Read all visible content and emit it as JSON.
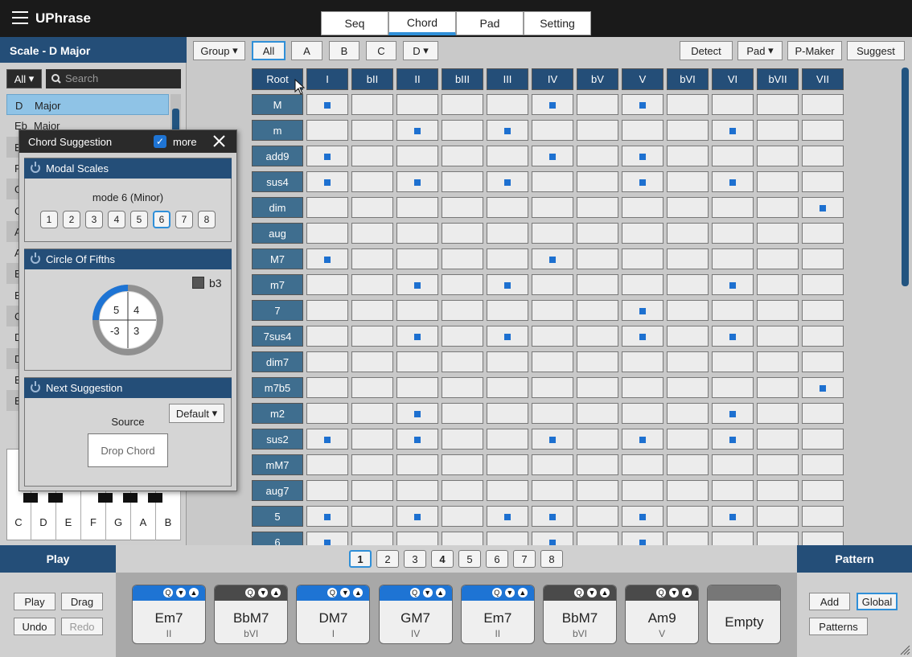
{
  "app": {
    "title": "UPhrase"
  },
  "tabs": [
    "Seq",
    "Chord",
    "Pad",
    "Setting"
  ],
  "scale": {
    "header": "Scale - ",
    "name": "D Major",
    "filter": "All",
    "search_placeholder": "Search",
    "items": [
      {
        "key": "D",
        "name": "Major"
      },
      {
        "key": "Eb",
        "name": "Major"
      },
      {
        "key": "E",
        "name": ""
      },
      {
        "key": "F",
        "name": ""
      },
      {
        "key": "G",
        "name": ""
      },
      {
        "key": "G",
        "name": ""
      },
      {
        "key": "A",
        "name": ""
      },
      {
        "key": "A",
        "name": ""
      },
      {
        "key": "B",
        "name": ""
      },
      {
        "key": "B",
        "name": ""
      },
      {
        "key": "C",
        "name": ""
      },
      {
        "key": "D",
        "name": ""
      },
      {
        "key": "D",
        "name": ""
      },
      {
        "key": "E",
        "name": ""
      },
      {
        "key": "E",
        "name": ""
      }
    ]
  },
  "piano": {
    "keys": [
      "C",
      "D",
      "E",
      "F",
      "G",
      "A",
      "B"
    ],
    "marked": [
      false,
      true,
      true,
      false,
      true,
      false,
      true
    ]
  },
  "toolbar": {
    "group": "Group",
    "all": "All",
    "a": "A",
    "b": "B",
    "c": "C",
    "d": "D",
    "detect": "Detect",
    "pad": "Pad",
    "pmaker": "P-Maker",
    "suggest": "Suggest"
  },
  "grid": {
    "corner": "Root",
    "columns": [
      "I",
      "bII",
      "II",
      "bIII",
      "III",
      "IV",
      "bV",
      "V",
      "bVI",
      "VI",
      "bVII",
      "VII"
    ],
    "rows": [
      {
        "label": "M",
        "marks": [
          0,
          5,
          7
        ]
      },
      {
        "label": "m",
        "marks": [
          2,
          4,
          9
        ]
      },
      {
        "label": "add9",
        "marks": [
          0,
          5,
          7
        ]
      },
      {
        "label": "sus4",
        "marks": [
          0,
          2,
          4,
          7,
          9
        ]
      },
      {
        "label": "dim",
        "marks": [
          11
        ]
      },
      {
        "label": "aug",
        "marks": []
      },
      {
        "label": "M7",
        "marks": [
          0,
          5
        ]
      },
      {
        "label": "m7",
        "marks": [
          2,
          4,
          9
        ]
      },
      {
        "label": "7",
        "marks": [
          7
        ]
      },
      {
        "label": "7sus4",
        "marks": [
          2,
          4,
          7,
          9
        ]
      },
      {
        "label": "dim7",
        "marks": []
      },
      {
        "label": "m7b5",
        "marks": [
          11
        ]
      },
      {
        "label": "m2",
        "marks": [
          2,
          9
        ]
      },
      {
        "label": "sus2",
        "marks": [
          0,
          2,
          5,
          7,
          9
        ]
      },
      {
        "label": "mM7",
        "marks": []
      },
      {
        "label": "aug7",
        "marks": []
      },
      {
        "label": "5",
        "marks": [
          0,
          2,
          4,
          5,
          7,
          9
        ]
      },
      {
        "label": "6",
        "marks": [
          0,
          5,
          7
        ]
      }
    ]
  },
  "popup": {
    "title": "Chord Suggestion",
    "more": "more",
    "modal": {
      "title": "Modal Scales",
      "mode_label": "mode 6 (Minor)",
      "modes": [
        "1",
        "2",
        "3",
        "4",
        "5",
        "6",
        "7",
        "8"
      ],
      "active": 5
    },
    "circle": {
      "title": "Circle Of Fifths",
      "legend": "b3",
      "q1": "5",
      "q2": "4",
      "q3": "-3",
      "q4": "3"
    },
    "next": {
      "title": "Next Suggestion",
      "dropdown": "Default",
      "source_label": "Source",
      "drop": "Drop Chord"
    }
  },
  "bottom": {
    "play_title": "Play",
    "pattern_title": "Pattern",
    "play_buttons": {
      "play": "Play",
      "drag": "Drag",
      "undo": "Undo",
      "redo": "Redo"
    },
    "pattern_buttons": {
      "add": "Add",
      "global": "Global",
      "patterns": "Patterns"
    },
    "pages": [
      "1",
      "2",
      "3",
      "4",
      "5",
      "6",
      "7",
      "8"
    ],
    "pads": [
      {
        "name": "Em7",
        "degree": "II",
        "style": "blue"
      },
      {
        "name": "BbM7",
        "degree": "bVI",
        "style": "gray"
      },
      {
        "name": "DM7",
        "degree": "I",
        "style": "blue"
      },
      {
        "name": "GM7",
        "degree": "IV",
        "style": "blue"
      },
      {
        "name": "Em7",
        "degree": "II",
        "style": "blue"
      },
      {
        "name": "BbM7",
        "degree": "bVI",
        "style": "gray"
      },
      {
        "name": "Am9",
        "degree": "V",
        "style": "gray"
      },
      {
        "name": "Empty",
        "degree": "",
        "style": "light"
      }
    ]
  },
  "colors": {
    "accent": "#2f8fd8",
    "header": "#244e78",
    "dot": "#1d70d0"
  }
}
